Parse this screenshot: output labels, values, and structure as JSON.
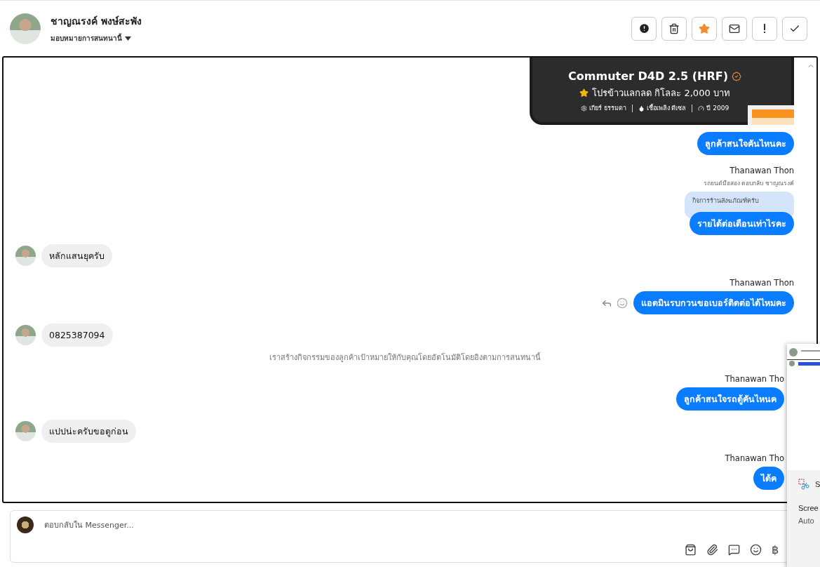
{
  "header": {
    "name": "ชาญณรงค์ พงษ์สะพัง",
    "assign": "มอบหมายการสนทนานี้",
    "actions": [
      {
        "kind": "alert"
      },
      {
        "kind": "trash"
      },
      {
        "kind": "star",
        "selected": true
      },
      {
        "kind": "mail"
      },
      {
        "kind": "bang"
      },
      {
        "kind": "check"
      }
    ]
  },
  "messages": [
    {
      "kind": "card",
      "title": "Commuter D4D 2.5 (HRF)",
      "promo": "โปรข้าวแลกลด กิโลละ 2,000 บาท",
      "specs": [
        "เกียร์ ธรรมดา",
        "เชื้อเพลิง ดีเซล",
        "ปี 2009"
      ]
    },
    {
      "kind": "out",
      "text": "ลูกค้าสนใจคันไหนคะ"
    },
    {
      "kind": "sender",
      "text": "Thanawan Thon"
    },
    {
      "kind": "reply",
      "text": "รถยนต์มือสอง ตอบกลับ ชาญณรงค์",
      "quote": "กิจการร้านสังฆภัณฑ์ครับ"
    },
    {
      "kind": "out",
      "text": "รายได้ต่อเดือนเท่าไรคะ"
    },
    {
      "kind": "in",
      "text": "หลักแสนยุครับ"
    },
    {
      "kind": "sender",
      "text": "Thanawan Thon"
    },
    {
      "kind": "out",
      "text": "แอดมินรบกวนขอเบอร์ติดต่อได้ไหมคะ",
      "hovered": true
    },
    {
      "kind": "in",
      "text": "0825387094"
    },
    {
      "kind": "system",
      "text": "เราสร้างกิจกรรมของลูกค้าเป้าหมายให้กับคุณโดยอัตโนมัติโดยอิงตามการสนทนานี้"
    },
    {
      "kind": "sender",
      "text": "Thanawan Tho"
    },
    {
      "kind": "out",
      "text": "ลูกค้าสนใจรถตู้คันไหนค"
    },
    {
      "kind": "in",
      "text": "แปปน่ะครับขอดูก่อน"
    },
    {
      "kind": "sender",
      "text": "Thanawan Tho"
    },
    {
      "kind": "out",
      "text": "ได้ค"
    }
  ],
  "composer": {
    "placeholder": "ตอบกลับใน Messenger...",
    "tools": [
      {
        "kind": "bag"
      },
      {
        "kind": "clip"
      },
      {
        "kind": "chat"
      },
      {
        "kind": "smile"
      },
      {
        "kind": "baht",
        "text": "฿"
      }
    ]
  },
  "toast": {
    "app": "S",
    "lines": [
      "Scree",
      "Auto"
    ]
  }
}
